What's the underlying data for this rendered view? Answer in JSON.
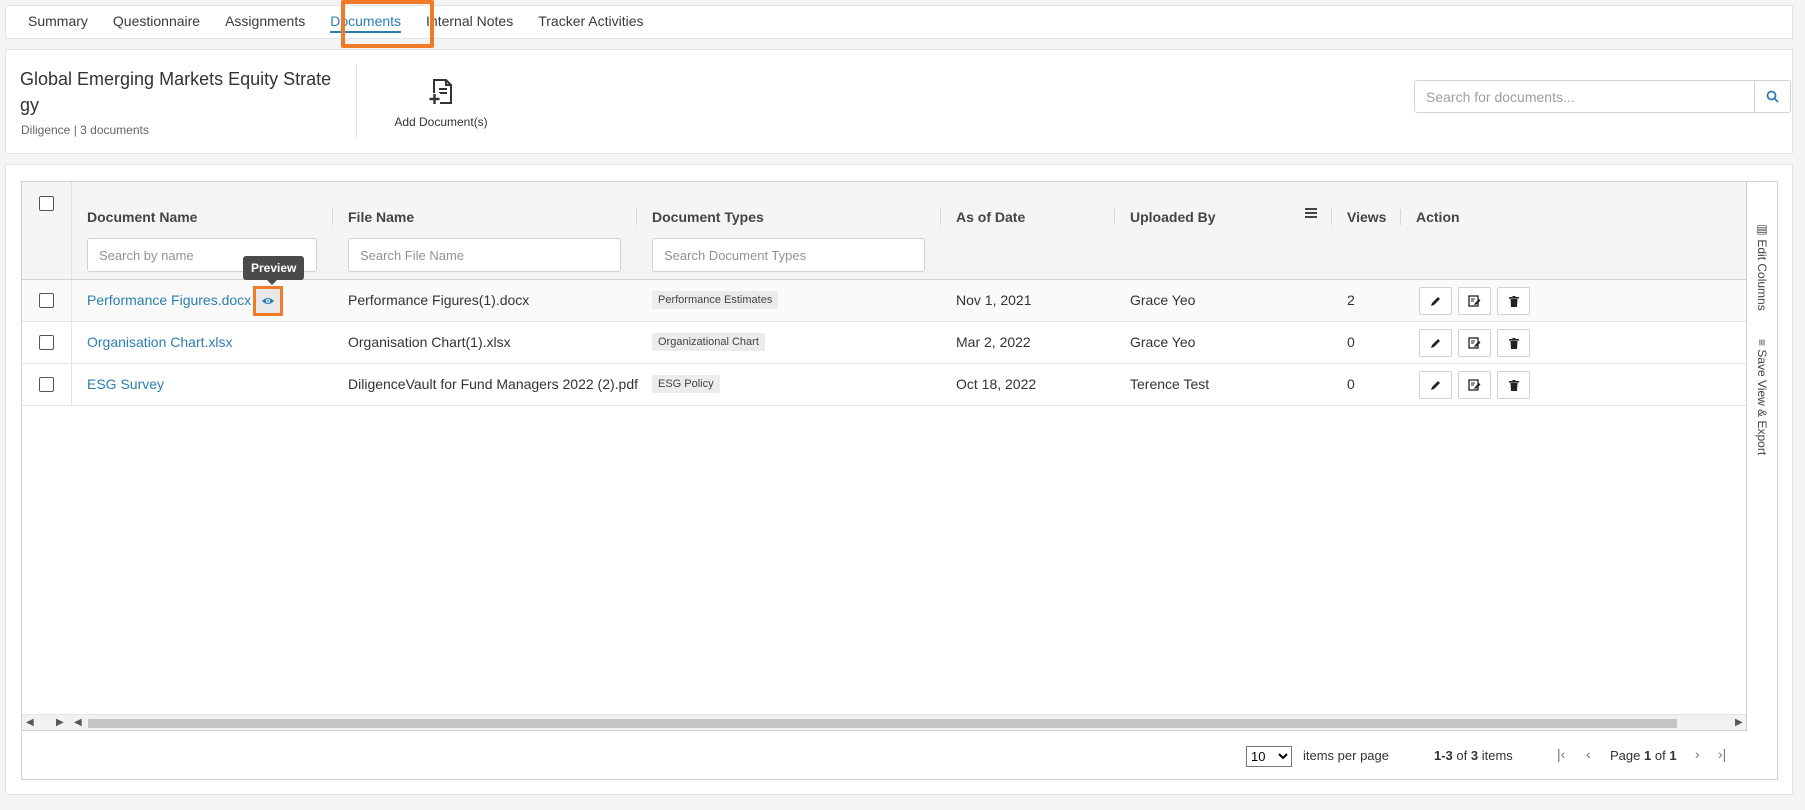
{
  "tabs": [
    {
      "label": "Summary"
    },
    {
      "label": "Questionnaire"
    },
    {
      "label": "Assignments"
    },
    {
      "label": "Documents"
    },
    {
      "label": "Internal Notes"
    },
    {
      "label": "Tracker Activities"
    }
  ],
  "header": {
    "title": "Global Emerging Markets Equity Strategy",
    "subtitle": "Diligence | 3 documents",
    "add_document_label": "Add Document(s)",
    "search_placeholder": "Search for documents..."
  },
  "grid": {
    "columns": {
      "document_name": "Document Name",
      "file_name": "File Name",
      "document_types": "Document Types",
      "as_of_date": "As of Date",
      "uploaded_by": "Uploaded By",
      "views": "Views",
      "action": "Action"
    },
    "filters": {
      "name_placeholder": "Search by name",
      "file_placeholder": "Search File Name",
      "type_placeholder": "Search Document Types"
    },
    "rows": [
      {
        "name": "Performance Figures.docx",
        "file": "Performance Figures(1).docx",
        "type": "Performance Estimates",
        "date": "Nov 1, 2021",
        "uploader": "Grace Yeo",
        "views": "2"
      },
      {
        "name": "Organisation Chart.xlsx",
        "file": "Organisation Chart(1).xlsx",
        "type": "Organizational Chart",
        "date": "Mar 2, 2022",
        "uploader": "Grace Yeo",
        "views": "0"
      },
      {
        "name": "ESG Survey",
        "file": "DiligenceVault for Fund Managers 2022 (2).pdf",
        "type": "ESG Policy",
        "date": "Oct 18, 2022",
        "uploader": "Terence Test",
        "views": "0"
      }
    ],
    "tooltip": "Preview"
  },
  "side_rail": {
    "edit_columns": "Edit Columns",
    "save_view": "Save View & Export"
  },
  "pager": {
    "page_size": "10",
    "items_per_page": "items per page",
    "range": "1-3",
    "of": "of",
    "total": "3",
    "items": "items",
    "page_label": "Page",
    "current": "1",
    "pages": "1"
  },
  "colors": {
    "accent": "#2a7fb0",
    "highlight": "#f07a28"
  }
}
